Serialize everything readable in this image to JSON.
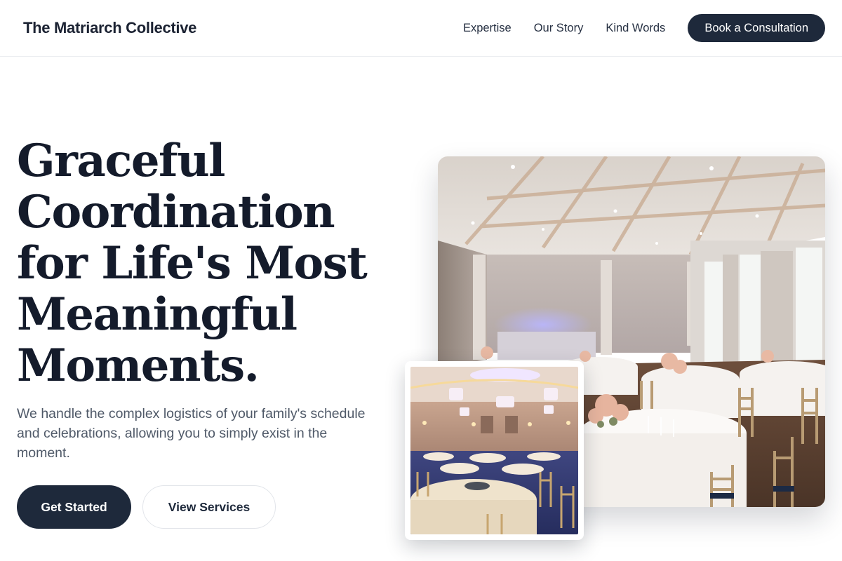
{
  "header": {
    "brand": "The Matriarch Collective",
    "nav": [
      {
        "label": "Expertise"
      },
      {
        "label": "Our Story"
      },
      {
        "label": "Kind Words"
      }
    ],
    "cta_label": "Book a Consultation"
  },
  "hero": {
    "title": "Graceful Coordination for Life's Most Meaningful Moments.",
    "subtitle": "We handle the complex logistics of your family's schedule and celebrations, allowing you to simply exist in the moment.",
    "primary_button": "Get Started",
    "secondary_button": "View Services",
    "images": [
      {
        "name": "banquet-hall-photo"
      },
      {
        "name": "ballroom-chandeliers-photo"
      }
    ]
  },
  "colors": {
    "dark_navy": "#1e293b",
    "heading": "#141b2b",
    "body_text": "#4f5968",
    "border": "#e2e5ea"
  }
}
